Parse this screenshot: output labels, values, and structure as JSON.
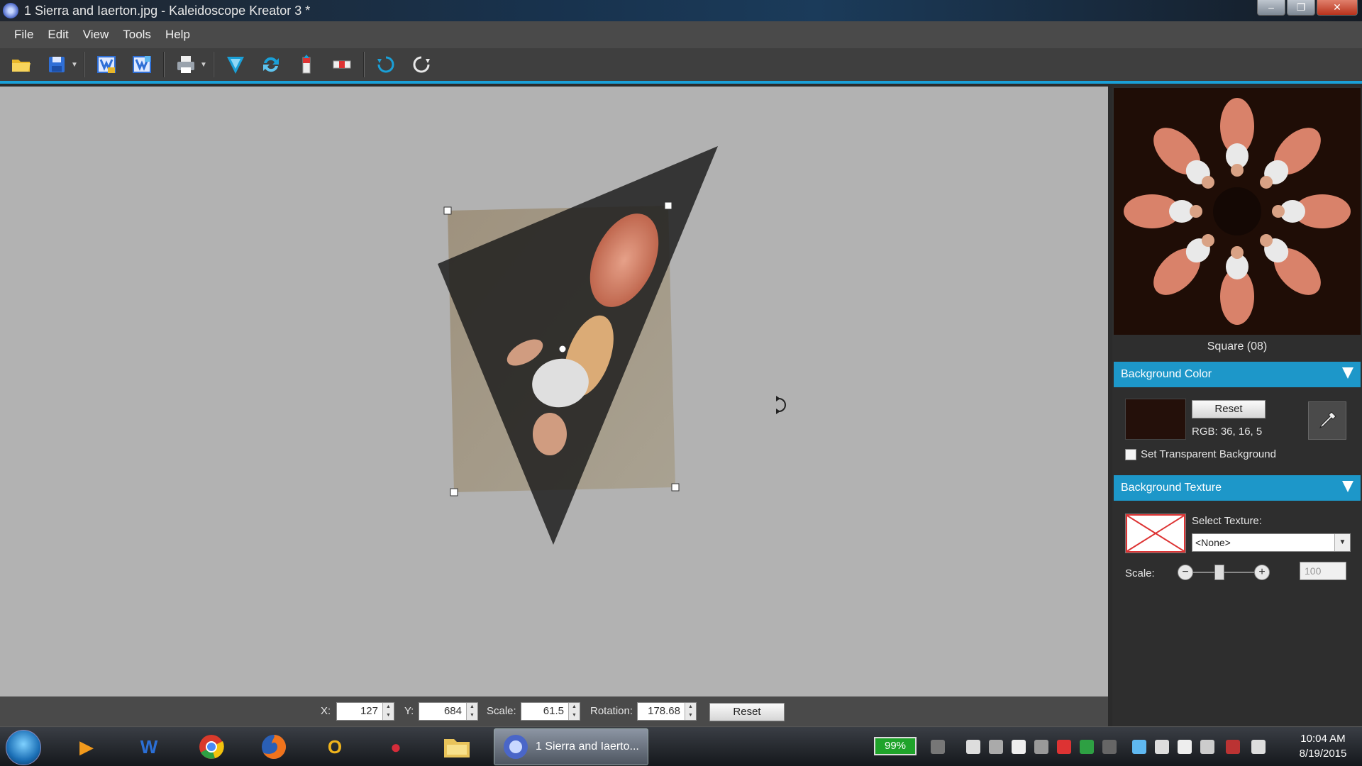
{
  "window": {
    "title": "1 Sierra and Iaerton.jpg - Kaleidoscope Kreator 3 *",
    "minimize": "–",
    "maximize": "❐",
    "close": "✕"
  },
  "menu": [
    "File",
    "Edit",
    "View",
    "Tools",
    "Help"
  ],
  "toolbar": {
    "tools": [
      "open-folder-icon",
      "save-icon",
      "export-image-icon",
      "export-image-alt-icon",
      "print-icon",
      "funnel-filter-icon",
      "flip-icon",
      "vertical-flip-icon",
      "horizontal-flip-icon",
      "rotate-left-icon",
      "rotate-right-icon"
    ],
    "accent": "#1aa0d8"
  },
  "preview": {
    "label": "Square (08)"
  },
  "background_color": {
    "header": "Background Color",
    "reset_label": "Reset",
    "rgb_text": "RGB: 36, 16, 5",
    "swatch": "#24100a",
    "transparent_label": "Set Transparent Background",
    "transparent_checked": false
  },
  "background_texture": {
    "header": "Background Texture",
    "select_label": "Select Texture:",
    "selected": "<None>",
    "scale_label": "Scale:",
    "scale_value": "100"
  },
  "status": {
    "x_label": "X:",
    "x_value": "127",
    "y_label": "Y:",
    "y_value": "684",
    "scale_label": "Scale:",
    "scale_value": "61.5",
    "rotation_label": "Rotation:",
    "rotation_value": "178.68",
    "reset_label": "Reset"
  },
  "taskbar": {
    "active_label": "1 Sierra and Iaerto...",
    "battery": "99%",
    "time": "10:04 AM",
    "date": "8/19/2015",
    "apps": [
      "media-player-icon",
      "word-icon",
      "chrome-icon",
      "firefox-icon",
      "outlook-icon",
      "app-red-icon",
      "file-explorer-icon"
    ]
  }
}
